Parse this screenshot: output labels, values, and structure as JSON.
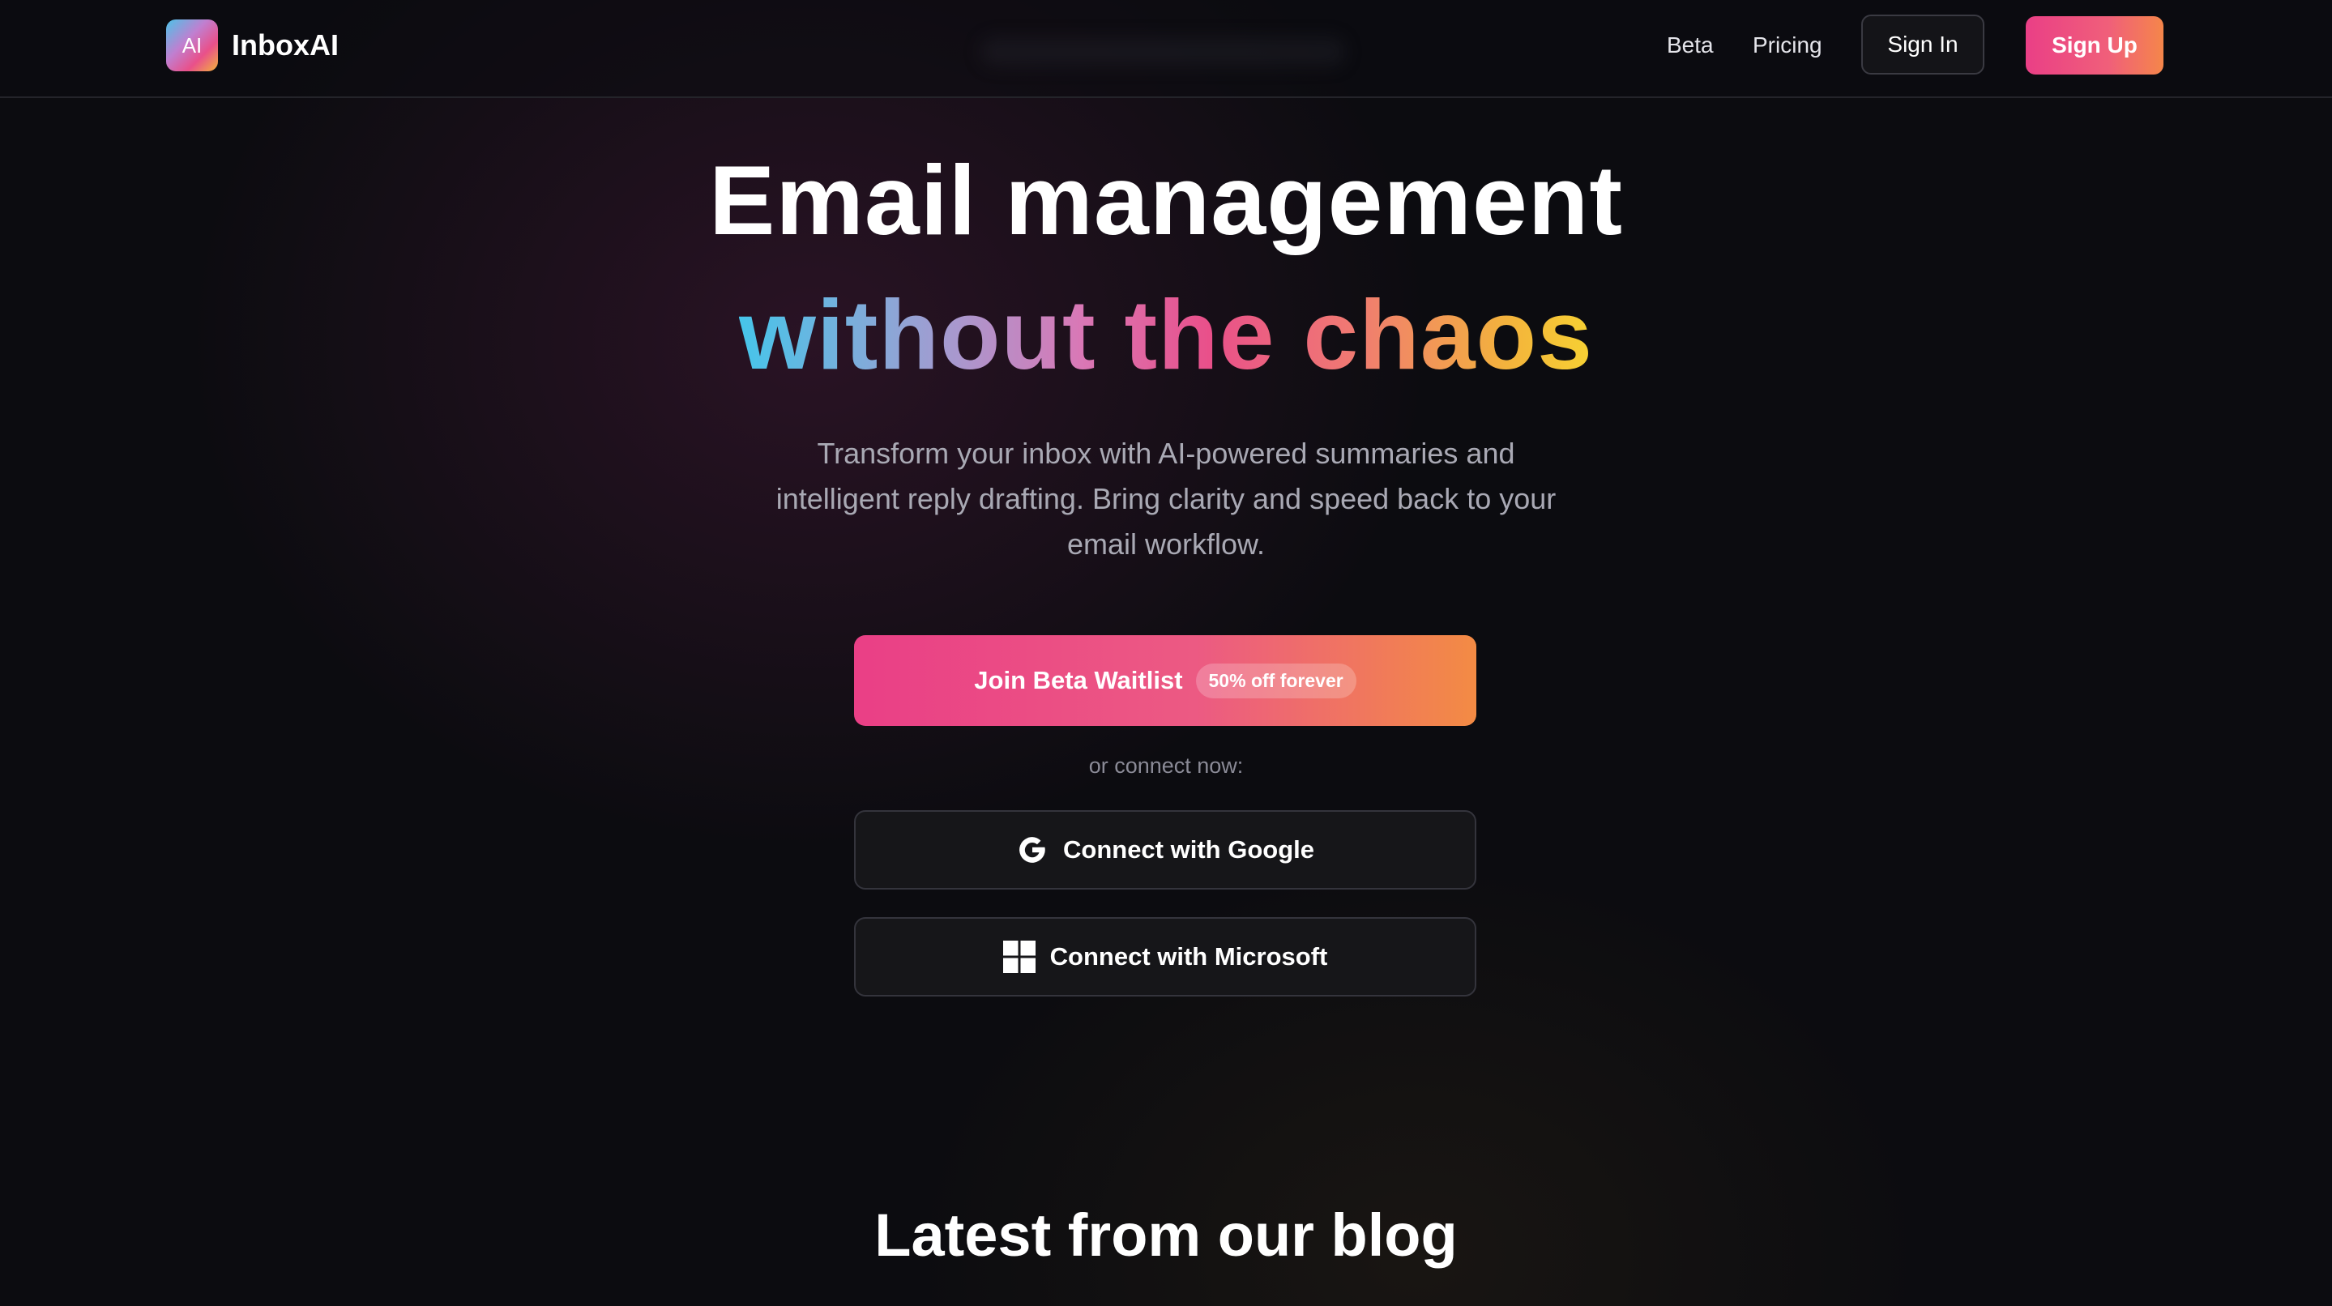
{
  "nav": {
    "logo_badge": "AI",
    "logo_text": "InboxAI",
    "links": [
      "Beta",
      "Pricing"
    ],
    "sign_in": "Sign In",
    "sign_up": "Sign Up"
  },
  "hero": {
    "title_line1": "Email management",
    "title_line2": "without the chaos",
    "subtitle": "Transform your inbox with AI-powered summaries and intelligent reply drafting. Bring clarity and speed back to your email workflow.",
    "waitlist_button": "Join Beta Waitlist",
    "waitlist_badge": "50% off forever",
    "connect_prompt": "or connect now:",
    "connect_google": "Connect with Google",
    "connect_microsoft": "Connect with Microsoft"
  },
  "blog": {
    "title": "Latest from our blog"
  },
  "colors": {
    "background": "#0c0c10",
    "accent_pink": "#ea3f86",
    "accent_orange": "#f38b44",
    "gradient_blue": "#46c5ea",
    "gradient_yellow": "#f7d233"
  },
  "icons": {
    "google": "google-g-icon",
    "microsoft": "windows-grid-icon"
  }
}
